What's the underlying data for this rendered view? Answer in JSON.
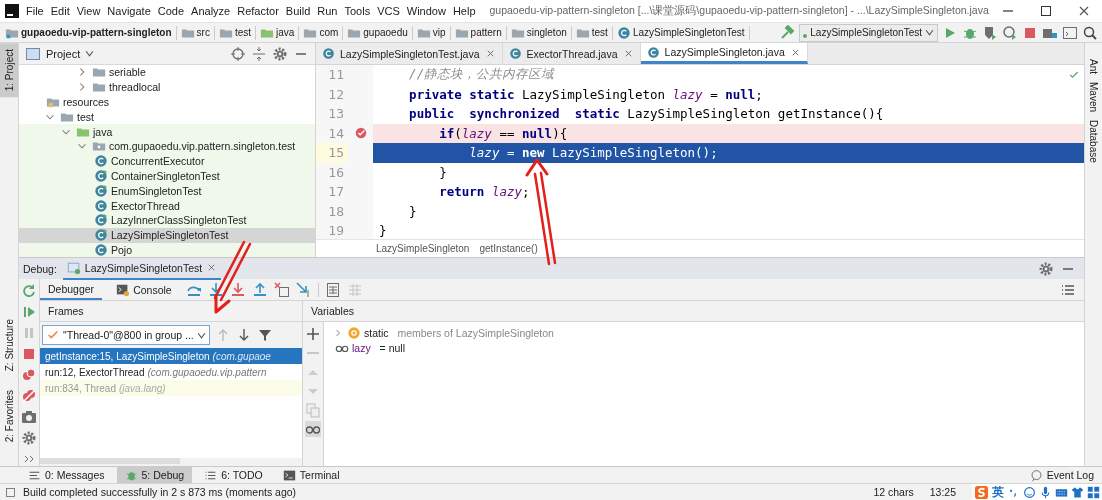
{
  "window": {
    "title": "gupaoedu-vip-pattern-singleton [...\\课堂源码\\gupaoedu-vip-pattern-singleton] - ...\\LazySimpleSingleton.java"
  },
  "menu": [
    "File",
    "Edit",
    "View",
    "Navigate",
    "Code",
    "Analyze",
    "Refactor",
    "Build",
    "Run",
    "Tools",
    "VCS",
    "Window",
    "Help"
  ],
  "nav_path": [
    {
      "label": "gupaoedu-vip-pattern-singleton",
      "kind": "module"
    },
    {
      "label": "src",
      "kind": "folder"
    },
    {
      "label": "test",
      "kind": "folder"
    },
    {
      "label": "java",
      "kind": "test-root"
    },
    {
      "label": "com",
      "kind": "folder"
    },
    {
      "label": "gupaoedu",
      "kind": "folder"
    },
    {
      "label": "vip",
      "kind": "folder"
    },
    {
      "label": "pattern",
      "kind": "folder"
    },
    {
      "label": "singleton",
      "kind": "folder"
    },
    {
      "label": "test",
      "kind": "folder"
    },
    {
      "label": "LazySimpleSingletonTest",
      "kind": "class"
    }
  ],
  "run_config": {
    "value": "LazySimpleSingletonTest"
  },
  "tool_strip_left": [
    {
      "label": "1: Project",
      "selected": true
    },
    {
      "label": "Z: Structure",
      "selected": false
    },
    {
      "label": "2: Favorites",
      "selected": false
    }
  ],
  "tool_strip_right": [
    "Ant",
    "Maven",
    "Database"
  ],
  "project": {
    "title": "Project",
    "scrolled_children": [
      {
        "label": "seriable",
        "kind": "folder",
        "expanded": false
      },
      {
        "label": "threadlocal",
        "kind": "folder",
        "expanded": false
      }
    ],
    "tree": [
      {
        "label": "resources",
        "kind": "resources",
        "selected": false
      },
      {
        "label": "test",
        "kind": "folder",
        "expanded": true,
        "selected": false,
        "children": [
          {
            "label": "java",
            "kind": "test-root",
            "expanded": true,
            "selected": false,
            "children": [
              {
                "label": "com.gupaoedu.vip.pattern.singleton.test",
                "kind": "package",
                "expanded": true,
                "selected": false,
                "children": [
                  {
                    "label": "ConcurrentExecutor",
                    "kind": "class",
                    "runnable": false,
                    "selected": false
                  },
                  {
                    "label": "ContainerSingletonTest",
                    "kind": "class",
                    "runnable": true,
                    "selected": false
                  },
                  {
                    "label": "EnumSingletonTest",
                    "kind": "class",
                    "runnable": true,
                    "selected": false
                  },
                  {
                    "label": "ExectorThread",
                    "kind": "class",
                    "runnable": false,
                    "selected": false
                  },
                  {
                    "label": "LazyInnerClassSingletonTest",
                    "kind": "class",
                    "runnable": true,
                    "selected": false
                  },
                  {
                    "label": "LazySimpleSingletonTest",
                    "kind": "class",
                    "runnable": true,
                    "selected": true
                  },
                  {
                    "label": "Pojo",
                    "kind": "class",
                    "runnable": false,
                    "selected": false
                  }
                ]
              }
            ]
          }
        ]
      }
    ]
  },
  "editor": {
    "tabs": [
      {
        "label": "LazySimpleSingletonTest.java",
        "selected": false
      },
      {
        "label": "ExectorThread.java",
        "selected": false
      },
      {
        "label": "LazySimpleSingleton.java",
        "selected": true
      }
    ],
    "lines": [
      {
        "number": "11",
        "breakpoint": false,
        "current": false,
        "tokens": [
          {
            "t": "    //静态块，公共内存区域",
            "kind": "comment"
          }
        ]
      },
      {
        "number": "12",
        "breakpoint": false,
        "current": false,
        "tokens": [
          {
            "t": "    private static ",
            "kind": "keyword"
          },
          {
            "t": "LazySimpleSingleton ",
            "kind": "plain"
          },
          {
            "t": "lazy",
            "kind": "field"
          },
          {
            "t": " = ",
            "kind": "plain"
          },
          {
            "t": "null",
            "kind": "keyword"
          },
          {
            "t": ";",
            "kind": "plain"
          }
        ]
      },
      {
        "number": "13",
        "breakpoint": false,
        "current": false,
        "tokens": [
          {
            "t": "    public  synchronized  static ",
            "kind": "keyword"
          },
          {
            "t": "LazySimpleSingleton getInstance(){",
            "kind": "plain"
          }
        ]
      },
      {
        "number": "14",
        "breakpoint": true,
        "current": false,
        "tokens": [
          {
            "t": "        if",
            "kind": "keyword"
          },
          {
            "t": "(",
            "kind": "plain"
          },
          {
            "t": "lazy",
            "kind": "field"
          },
          {
            "t": " == ",
            "kind": "plain"
          },
          {
            "t": "null",
            "kind": "keyword"
          },
          {
            "t": "){",
            "kind": "plain"
          }
        ]
      },
      {
        "number": "15",
        "breakpoint": false,
        "current": true,
        "tokens": [
          {
            "t": "            lazy",
            "kind": "field"
          },
          {
            "t": " = ",
            "kind": "plain"
          },
          {
            "t": "new",
            "kind": "keyword"
          },
          {
            "t": " LazySimpleSingleton();",
            "kind": "plain"
          }
        ]
      },
      {
        "number": "16",
        "breakpoint": false,
        "current": false,
        "tokens": [
          {
            "t": "        }",
            "kind": "plain"
          }
        ]
      },
      {
        "number": "17",
        "breakpoint": false,
        "current": false,
        "tokens": [
          {
            "t": "        return ",
            "kind": "keyword"
          },
          {
            "t": "lazy",
            "kind": "field"
          },
          {
            "t": ";",
            "kind": "plain"
          }
        ]
      },
      {
        "number": "18",
        "breakpoint": false,
        "current": false,
        "tokens": [
          {
            "t": "    }",
            "kind": "plain"
          }
        ]
      },
      {
        "number": "19",
        "breakpoint": false,
        "current": false,
        "tokens": [
          {
            "t": "}",
            "kind": "plain"
          }
        ]
      }
    ],
    "breadcrumb": [
      "LazySimpleSingleton",
      "getInstance()"
    ]
  },
  "debug": {
    "label": "Debug:",
    "session": "LazySimpleSingletonTest",
    "tabs": [
      {
        "label": "Debugger",
        "selected": true
      },
      {
        "label": "Console",
        "selected": false
      }
    ],
    "frames_title": "Frames",
    "thread": "\"Thread-0\"@800 in group ...",
    "frames": [
      {
        "method": "getInstance:15, LazySimpleSingleton",
        "package": "(com.gupaoe",
        "kind": "user",
        "selected": true
      },
      {
        "method": "run:12, ExectorThread",
        "package": "(com.gupaoedu.vip.pattern",
        "kind": "user",
        "selected": false
      },
      {
        "method": "run:834, Thread",
        "package": "(java.lang)",
        "kind": "library",
        "selected": false
      }
    ],
    "variables_title": "Variables",
    "variables": [
      {
        "kind": "static",
        "name": "static",
        "text": "members of LazySimpleSingleton",
        "expanded": false
      },
      {
        "kind": "watch",
        "name": "lazy",
        "text": "= null"
      }
    ]
  },
  "bottom_tabs": [
    {
      "label": "0: Messages",
      "kind": "messages",
      "selected": false
    },
    {
      "label": "5: Debug",
      "kind": "debug",
      "selected": true
    },
    {
      "label": "6: TODO",
      "kind": "todo",
      "selected": false
    },
    {
      "label": "Terminal",
      "kind": "terminal",
      "selected": false
    }
  ],
  "event_log": "Event Log",
  "status_bar": {
    "message": "Build completed successfully in 2 s 873 ms (moments ago)",
    "chars": "12 chars",
    "position": "13:25"
  },
  "ime_bar": {
    "mode": "英"
  }
}
